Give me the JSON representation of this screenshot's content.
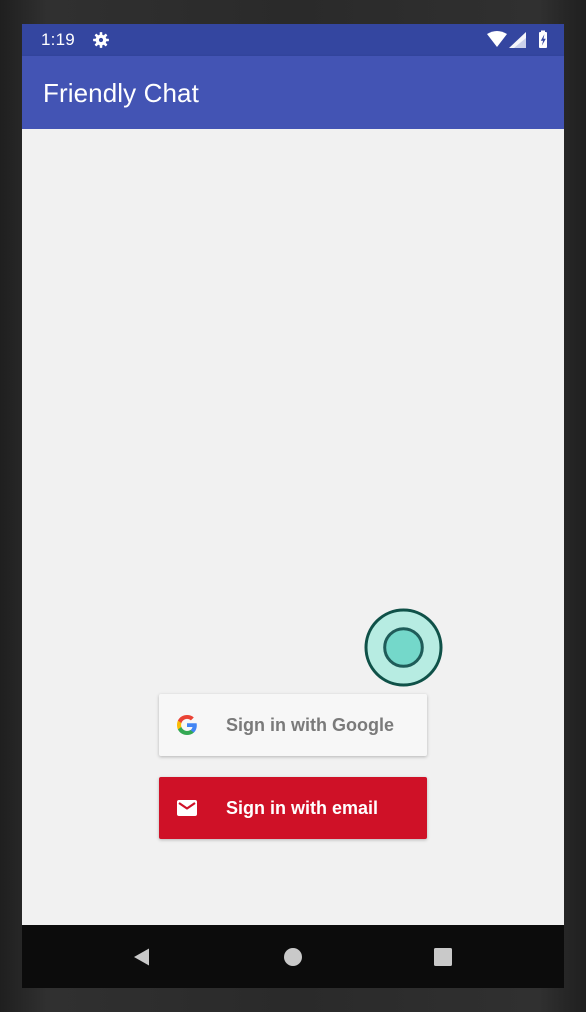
{
  "status_bar": {
    "time": "1:19",
    "icons": [
      "gear-icon",
      "wifi-icon",
      "signal-icon",
      "battery-charging-icon"
    ]
  },
  "app_bar": {
    "title": "Friendly Chat"
  },
  "auth": {
    "google_label": "Sign in with Google",
    "email_label": "Sign in with email",
    "google_icon": "google-logo-icon",
    "email_icon": "mail-icon"
  },
  "navigation": {
    "back_icon": "back-triangle-icon",
    "home_icon": "home-circle-icon",
    "recents_icon": "recents-square-icon"
  },
  "colors": {
    "status_bar": "#3446a0",
    "app_bar": "#4354b4",
    "background": "#f1f1f1",
    "google_button": "#f7f7f7",
    "email_button": "#cf1127",
    "nav_bar": "#0c0c0c"
  }
}
